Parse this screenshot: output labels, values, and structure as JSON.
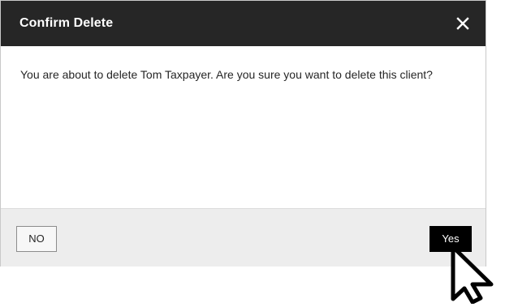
{
  "dialog": {
    "title": "Confirm Delete",
    "close_icon": "close-icon",
    "message": "You are about to delete Tom Taxpayer. Are you sure you want to delete this client?"
  },
  "footer": {
    "no_label": "NO",
    "yes_label": "Yes"
  },
  "colors": {
    "header_bg": "#262626",
    "footer_bg": "#ededed",
    "primary_button": "#000000"
  },
  "pointer_icon": "mouse-pointer-icon"
}
